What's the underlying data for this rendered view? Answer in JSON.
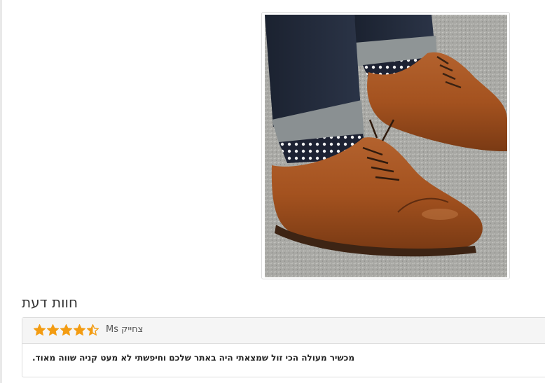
{
  "product": {
    "image_alt": "product-photo-brown-leather-shoes"
  },
  "reviews": {
    "heading": "חוות דעת",
    "items": [
      {
        "author": "צחייק Ms",
        "rating": 4.5,
        "rating_max": 5,
        "text": "מכשיר מעולה הכי זול שמצאתי היה באתר שלכם וחיפשתי לא מעט קניה שווה מאוד."
      }
    ]
  },
  "colors": {
    "star": "#f39c12",
    "highlight": "#ffff3a",
    "panel_header": "#f5f5f5",
    "border": "#dddddd"
  }
}
